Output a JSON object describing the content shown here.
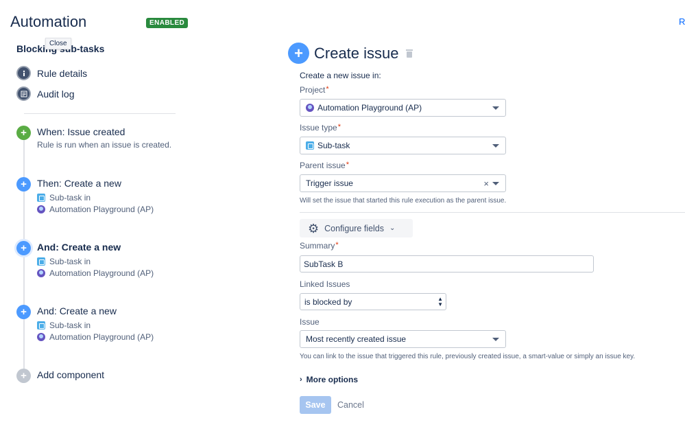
{
  "header": {
    "title": "Automation",
    "status_badge": "ENABLED",
    "right_link": "R"
  },
  "sidebar": {
    "rule_name": "Blocking sub-tasks",
    "tooltip": "Close",
    "nav": [
      {
        "label": "Rule details",
        "icon": "info-icon"
      },
      {
        "label": "Audit log",
        "icon": "list-icon"
      }
    ],
    "steps": [
      {
        "title": "When: Issue created",
        "desc": "Rule is run when an issue is created.",
        "icon": "plus-icon",
        "color": "#5aac44"
      },
      {
        "title": "Then: Create a new",
        "line1": "Sub-task in",
        "line2": "Automation Playground (AP)",
        "icon": "plus-icon",
        "color": "#4c9aff"
      },
      {
        "title": "And: Create a new",
        "line1": "Sub-task in",
        "line2": "Automation Playground (AP)",
        "icon": "plus-icon",
        "color": "#4c9aff",
        "selected": true
      },
      {
        "title": "And: Create a new",
        "line1": "Sub-task in",
        "line2": "Automation Playground (AP)",
        "icon": "plus-icon",
        "color": "#4c9aff"
      },
      {
        "title": "Add component",
        "icon": "plus-icon",
        "color": "#c1c7d0"
      }
    ]
  },
  "main": {
    "title": "Create issue",
    "intro": "Create a new issue in:",
    "project": {
      "label": "Project",
      "value": "Automation Playground (AP)"
    },
    "issue_type": {
      "label": "Issue type",
      "value": "Sub-task"
    },
    "parent_issue": {
      "label": "Parent issue",
      "value": "Trigger issue",
      "help": "Will set the issue that started this rule execution as the parent issue."
    },
    "configure_fields": "Configure fields",
    "summary": {
      "label": "Summary",
      "value": "SubTask B"
    },
    "linked_issues": {
      "label": "Linked Issues",
      "value": "is blocked by"
    },
    "issue": {
      "label": "Issue",
      "value": "Most recently created issue",
      "help": "You can link to the issue that triggered this rule, previously created issue, a smart-value or simply an issue key."
    },
    "more_options": "More options",
    "save": "Save",
    "cancel": "Cancel"
  }
}
